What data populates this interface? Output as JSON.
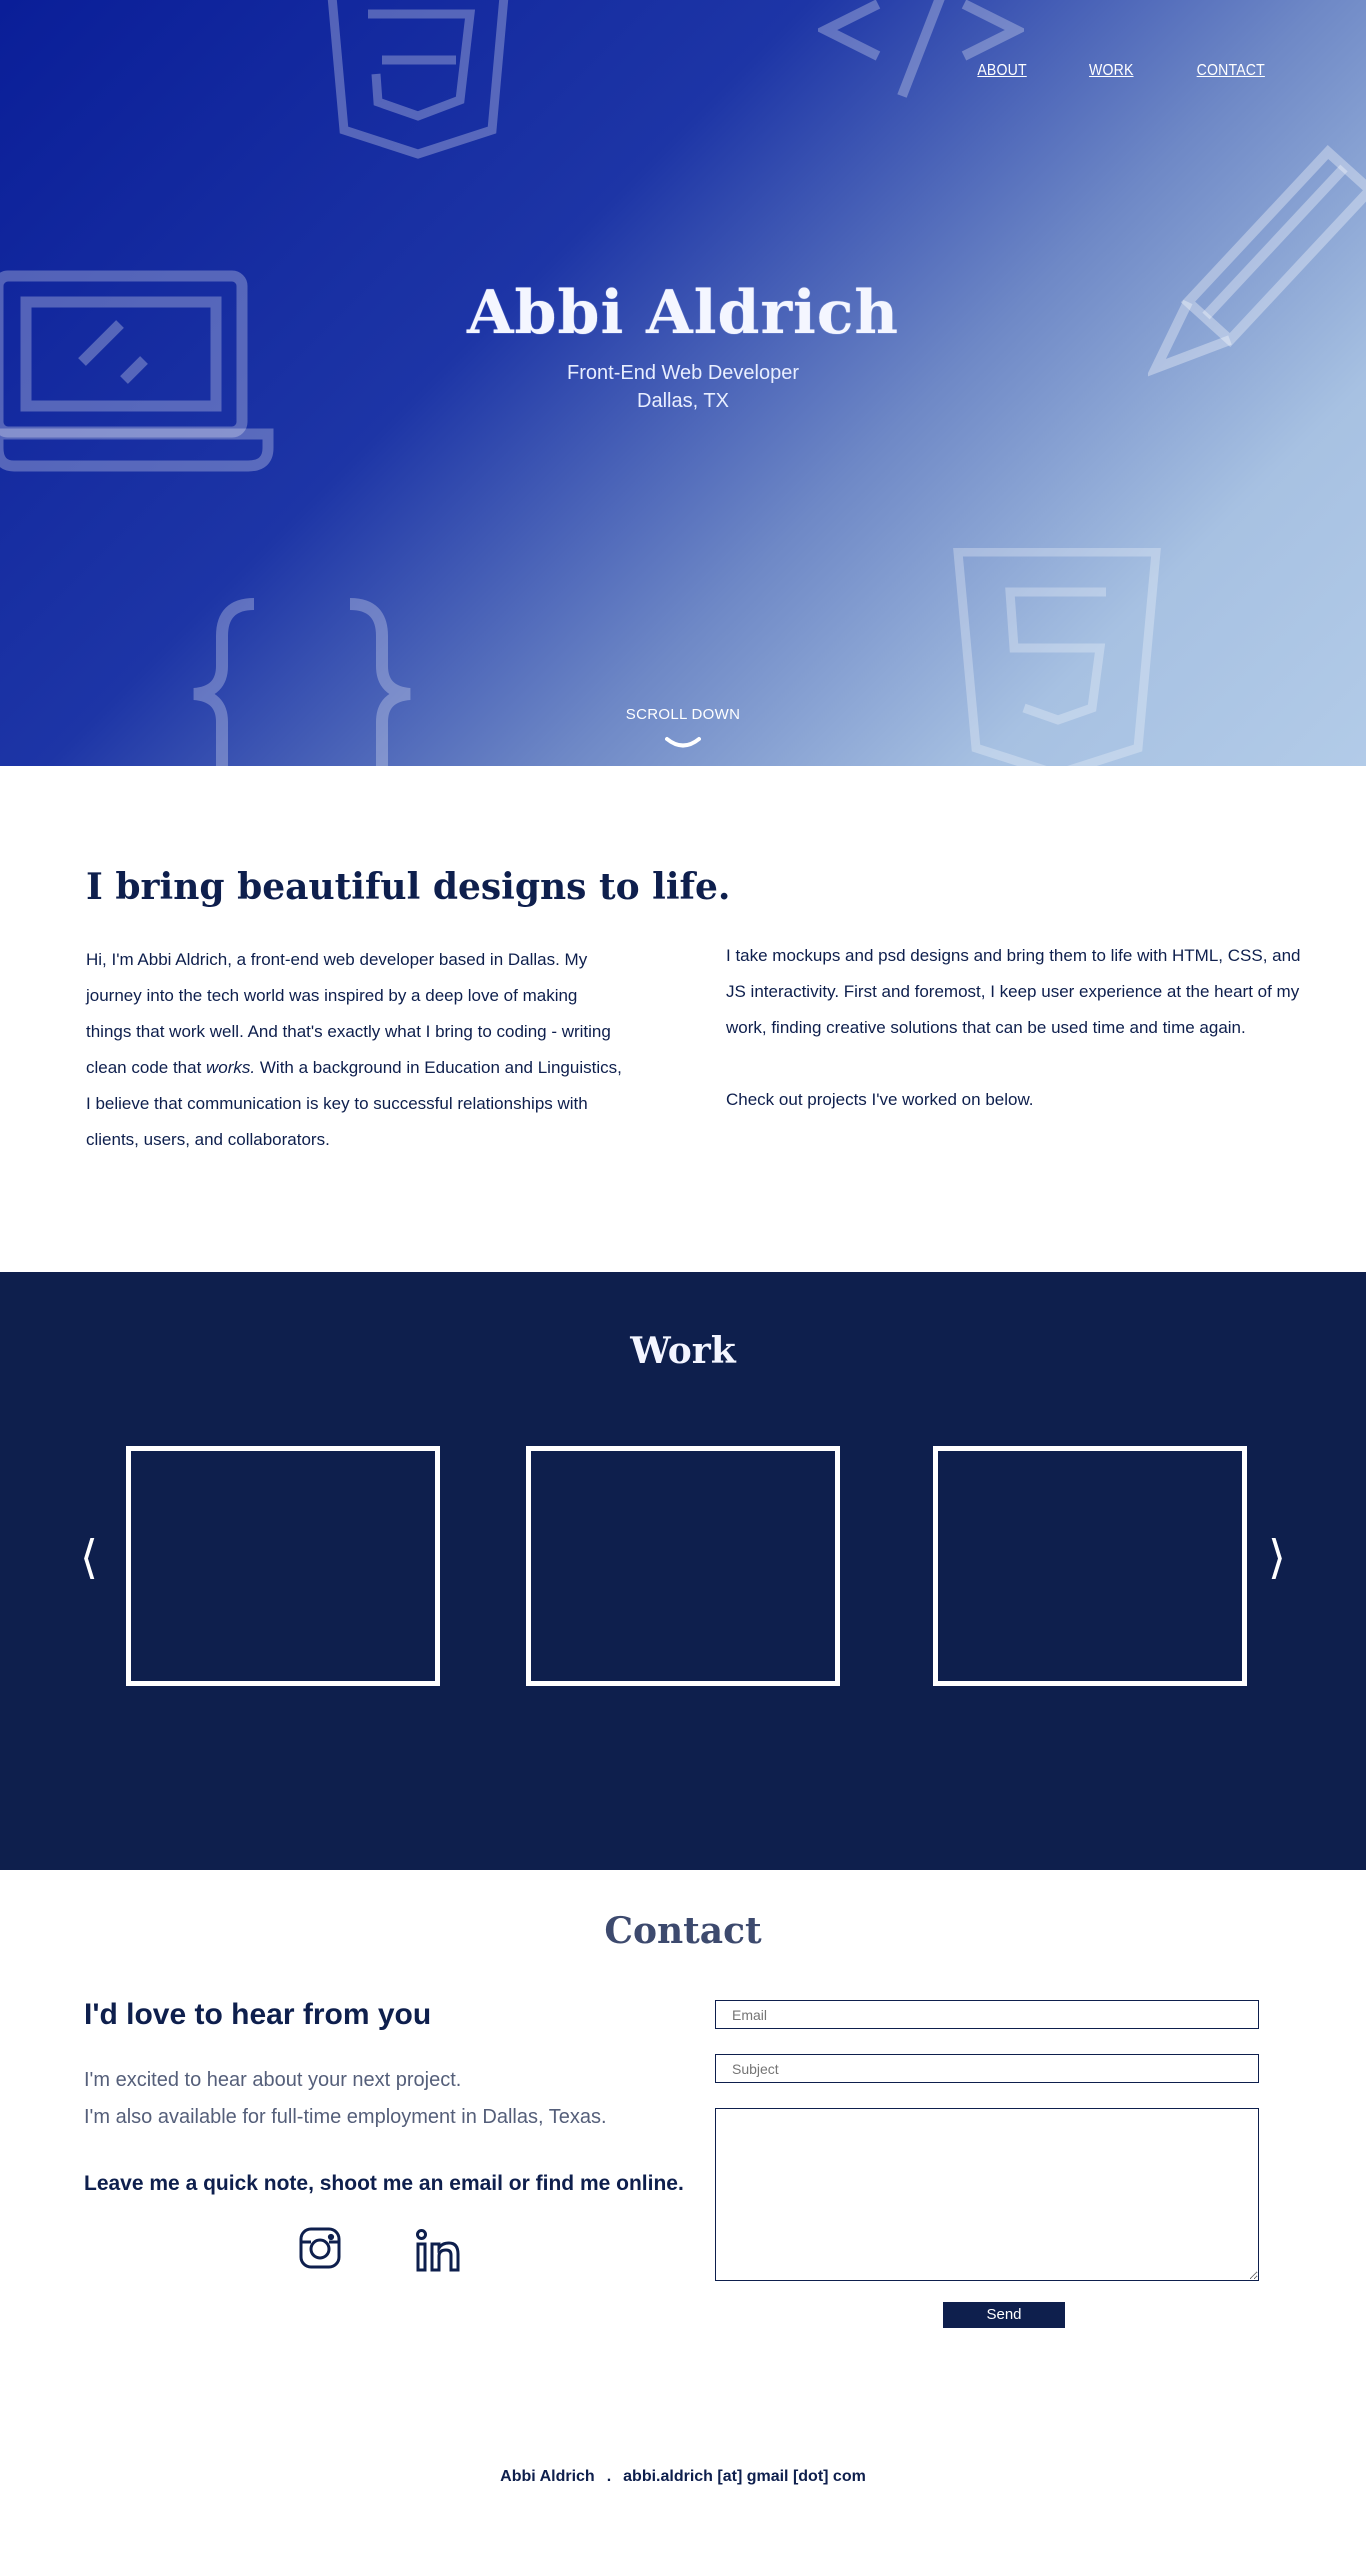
{
  "nav": {
    "items": [
      "ABOUT",
      "WORK",
      "CONTACT"
    ]
  },
  "hero": {
    "name": "Abbi Aldrich",
    "role": "Front-End Web Developer",
    "location": "Dallas, TX",
    "scroll_label": "SCROLL DOWN",
    "decorative_icons": [
      "css3-icon",
      "code-tag-icon",
      "laptop-icon",
      "pencil-icon",
      "curly-braces-icon",
      "html5-icon"
    ]
  },
  "about": {
    "heading": "I bring beautiful designs to life.",
    "left_paragraph_before": "Hi, I'm Abbi Aldrich, a front-end web developer based in Dallas. My journey into the tech world was inspired by a deep love of making things that work well.  And that's exactly what I bring to coding - writing clean code that ",
    "left_paragraph_emphasis": "works.",
    "left_paragraph_after": "  With a background in Education and Linguistics, I believe that communication is key to successful relationships with clients, users, and collaborators.",
    "right_paragraph_1": "I take mockups and psd designs and bring them to life with HTML, CSS, and JS interactivity.   First and foremost, I keep user experience at the heart of my work, finding creative solutions that can be used time and time again.",
    "right_paragraph_2": "Check out projects I've worked on below."
  },
  "work": {
    "title": "Work",
    "prev_arrow": "⟨",
    "next_arrow": "⟩"
  },
  "contact": {
    "title": "Contact",
    "heading": "I'd love to hear from you",
    "line_1": "I'm excited to hear about your next project.",
    "line_2": "I'm also available for full-time employment in Dallas, Texas.",
    "cta": "Leave me a quick note, shoot me an email or find me online.",
    "form": {
      "email_placeholder": "Email",
      "subject_placeholder": "Subject",
      "send_label": "Send"
    }
  },
  "footer": {
    "name": "Abbi Aldrich",
    "separator": ".",
    "email": "abbi.aldrich [at] gmail [dot] com"
  },
  "colors": {
    "navy": "#0e1f4d",
    "hero_gradient_start": "#0a1e98",
    "hero_gradient_end": "#b2cbe8",
    "white": "#ffffff"
  }
}
